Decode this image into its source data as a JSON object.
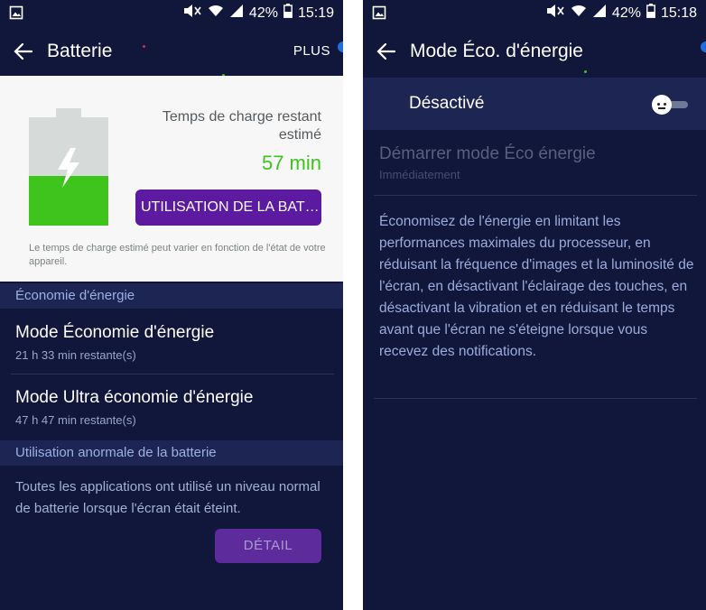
{
  "left": {
    "status": {
      "battery_pct": "42%",
      "time": "15:19"
    },
    "appbar": {
      "title": "Batterie",
      "plus_label": "PLUS"
    },
    "battery_level": 0.46,
    "charge": {
      "label": "Temps de charge restant estimé",
      "value": "57 min",
      "usage_button": "UTILISATION DE LA BAT…",
      "note": "Le temps de charge estimé peut varier en fonction de l'état de votre appareil."
    },
    "saving": {
      "header": "Économie d'énergie",
      "items": [
        {
          "title": "Mode Économie d'énergie",
          "sub": "21 h 33 min restante(s)"
        },
        {
          "title": "Mode Ultra économie d'énergie",
          "sub": "47 h 47 min restante(s)"
        }
      ]
    },
    "anomaly": {
      "header": "Utilisation anormale de la batterie",
      "text": "Toutes les applications ont utilisé un niveau normal de batterie lorsque l'écran était éteint.",
      "detail_button": "DÉTAIL"
    }
  },
  "right": {
    "status": {
      "battery_pct": "42%",
      "time": "15:18"
    },
    "appbar": {
      "title": "Mode Éco. d'énergie"
    },
    "toggle": {
      "label": "Désactivé",
      "state": "off"
    },
    "start": {
      "title": "Démarrer mode Éco énergie",
      "sub": "Immédiatement"
    },
    "description": "Économisez de l'énergie en limitant les performances maximales du processeur, en réduisant la fréquence d'images et la luminosité de l'écran, en désactivant l'éclairage des touches, en désactivant la vibration et en réduisant le temps avant que l'écran ne s'éteigne lorsque vous recevez des notifications."
  },
  "colors": {
    "background": "#10173a",
    "section": "#1d2652",
    "accent_green": "#3fc31d",
    "accent_purple": "#5b1aa0"
  },
  "icons": [
    "image-icon",
    "mute-icon",
    "wifi-icon",
    "signal-icon",
    "battery-icon",
    "back-arrow-icon",
    "lightning-icon",
    "toggle-switch"
  ]
}
